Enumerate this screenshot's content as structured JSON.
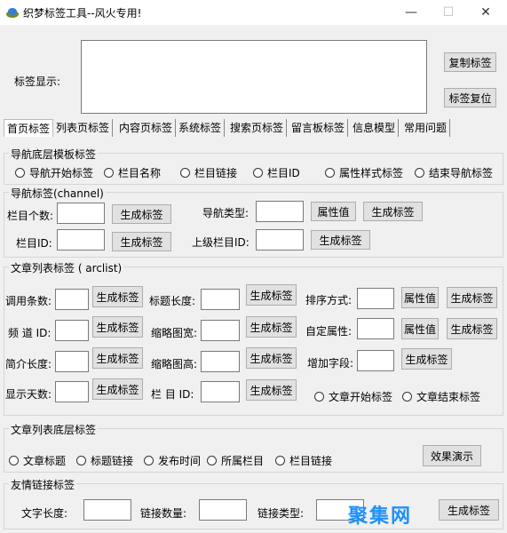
{
  "window": {
    "title": "织梦标签工具--风火专用!",
    "minimize": "—",
    "maximize": "☐",
    "close": "✕"
  },
  "display": {
    "label": "标签显示:",
    "copy": "复制标签",
    "reset": "标签复位"
  },
  "tabs": [
    "首页标签",
    "列表页标签",
    "内容页标签",
    "系统标签",
    "搜索页标签",
    "留言板标签",
    "信息模型",
    "常用问题"
  ],
  "nav_template": {
    "title": "导航底层模板标签",
    "options": [
      "导航开始标签",
      "栏目名称",
      "栏目链接",
      "栏目ID",
      "属性样式标签",
      "结束导航标签"
    ]
  },
  "channel": {
    "title": "导航标签(channel)",
    "col_count": "栏目个数:",
    "col_id": "栏目ID:",
    "nav_type": "导航类型:",
    "parent_id": "上级栏目ID:",
    "generate": "生成标签",
    "attr": "属性值"
  },
  "arclist": {
    "title": "文章列表标签 ( arclist)",
    "call_count": "调用条数:",
    "channel_id": "频 道 ID:",
    "intro_len": "简介长度:",
    "show_days": "显示天数:",
    "title_len": "标题长度:",
    "thumb_w": "缩略图宽:",
    "thumb_h": "缩略图高:",
    "col_id": "栏 目 ID:",
    "sort": "排序方式:",
    "custom_attr": "自定属性:",
    "add_field": "增加字段:",
    "generate": "生成标签",
    "attr": "属性值",
    "start": "文章开始标签",
    "end": "文章结束标签"
  },
  "arc_template": {
    "title": "文章列表底层标签",
    "options": [
      "文章标题",
      "标题链接",
      "发布时间",
      "所属栏目",
      "栏目链接"
    ],
    "demo": "效果演示"
  },
  "friendlink": {
    "title": "友情链接标签",
    "text_len": "文字长度:",
    "link_count": "链接数量:",
    "link_type": "链接类型:",
    "generate": "生成标签"
  },
  "watermark": "聚集网"
}
